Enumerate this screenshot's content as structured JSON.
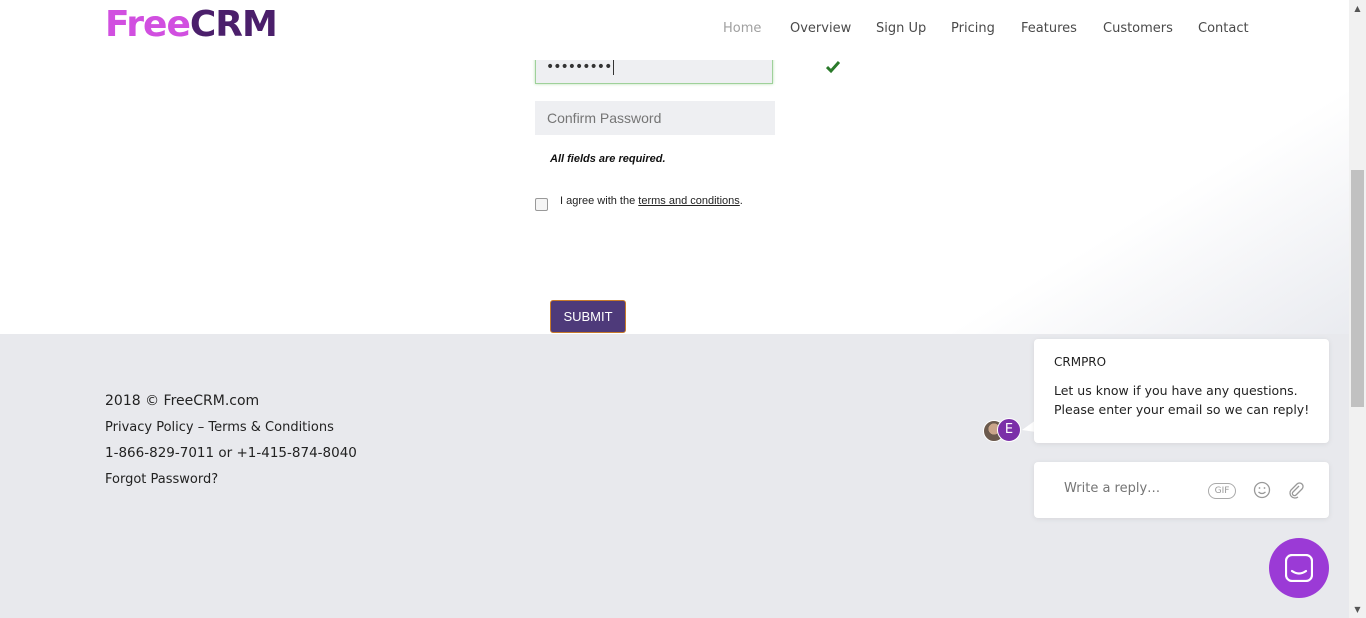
{
  "colors": {
    "logo_free": "#d14fe0",
    "logo_crm": "#4b1f6b",
    "submit_bg": "#4e3a7a",
    "launcher": "#9b3ad6",
    "valid_check": "#2a7a2a"
  },
  "header": {
    "logo_part1": "Free",
    "logo_part2": "CRM",
    "nav": [
      "Home",
      "Overview",
      "Sign Up",
      "Pricing",
      "Features",
      "Customers",
      "Contact"
    ],
    "active_nav": "Home"
  },
  "form": {
    "password_value": "•••••••••",
    "confirm_placeholder": "Confirm Password",
    "required_note": "All fields are required.",
    "agree_prefix": "I agree with the ",
    "agree_link": "terms and conditions",
    "agree_suffix": ".",
    "submit_label": "SUBMIT",
    "valid_icon": "check-icon"
  },
  "footer": {
    "copyright": "2018 © FreeCRM.com",
    "links": "Privacy Policy – Terms & Conditions",
    "phones": "1-866-829-7011 or +1-415-874-8040",
    "forgot": "Forgot Password?"
  },
  "chat": {
    "sender": "CRMPRO",
    "message_line1": "Let us know if you have any questions.",
    "message_line2": "Please enter your email so we can reply!",
    "avatar_letter": "E",
    "reply_placeholder": "Write a reply…",
    "gif_label": "GIF",
    "icons": [
      "emoji-icon",
      "paperclip-icon",
      "chat-launcher-icon"
    ]
  }
}
